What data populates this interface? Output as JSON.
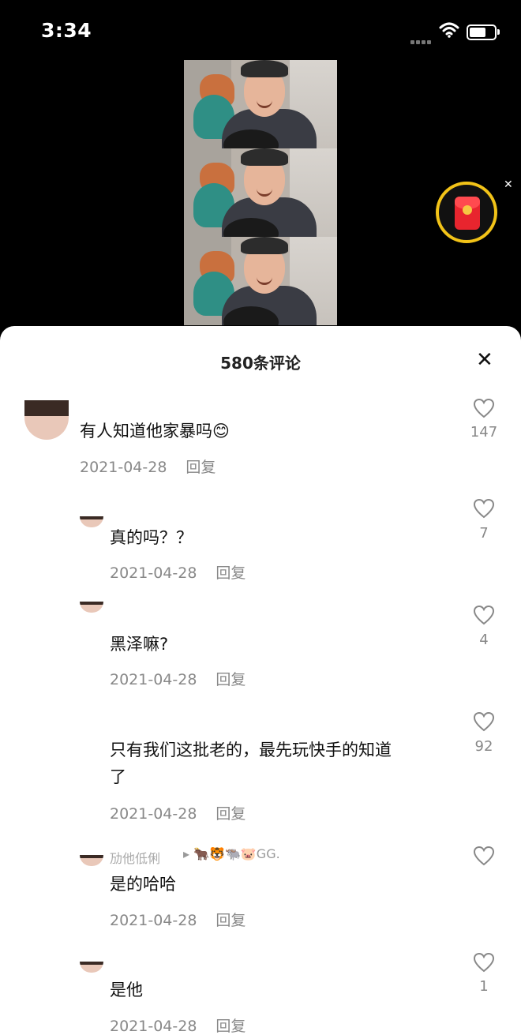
{
  "status_bar": {
    "time": "3:34"
  },
  "sheet": {
    "title": "580条评论",
    "close": "✕"
  },
  "comments": [
    {
      "text": "有人知道他家暴吗",
      "emoji": "😊",
      "date": "2021-04-28",
      "reply": "回复",
      "likes": "147"
    },
    {
      "text": "真的吗？？",
      "date": "2021-04-28",
      "reply": "回复",
      "likes": "7"
    },
    {
      "text": "黑泽嘛?",
      "date": "2021-04-28",
      "reply": "回复",
      "likes": "4"
    },
    {
      "text_line1": "只有我们这批老的，最先玩快手的知道",
      "text_line2": "了",
      "date": "2021-04-28",
      "reply": "回复",
      "likes": "92"
    },
    {
      "username": "劢他低俐",
      "emoji_strip": "▸ 🐂🐯🐃🐷GG.",
      "text": "是的哈哈",
      "date": "2021-04-28",
      "reply": "回复",
      "likes": ""
    },
    {
      "text": "是他",
      "date": "2021-04-28",
      "reply": "回复",
      "likes": "1"
    }
  ],
  "colors": {
    "accent_yellow": "#f2c318",
    "red_packet": "#e8252e"
  }
}
